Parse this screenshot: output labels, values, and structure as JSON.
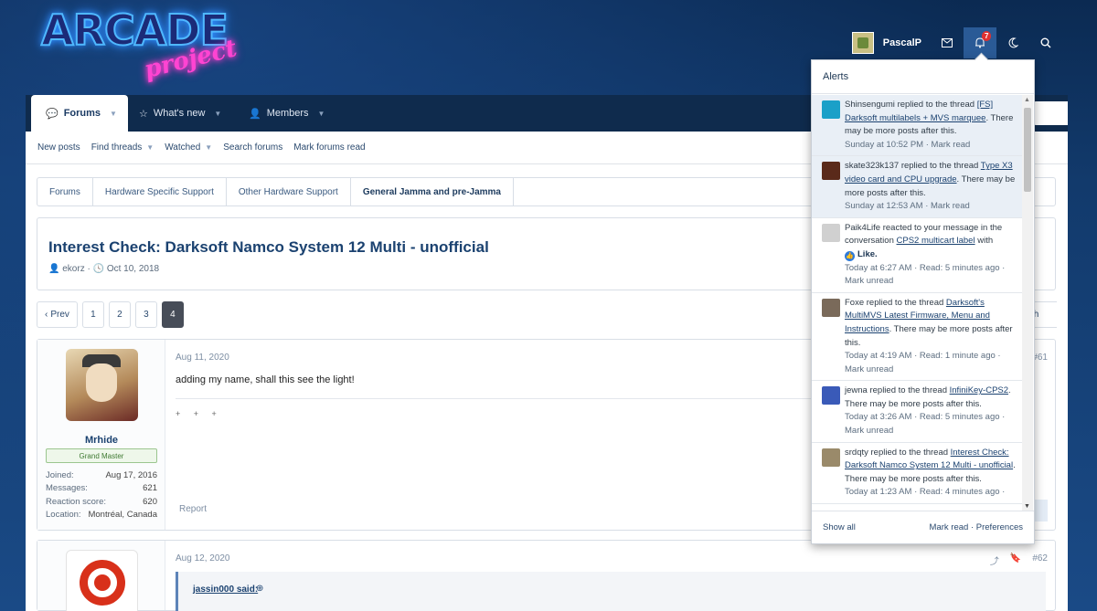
{
  "logo": {
    "main": "ARCADE",
    "sub": "project"
  },
  "user_bar": {
    "username": "PascalP",
    "alerts_count": "7"
  },
  "nav": {
    "tabs": [
      {
        "label": "Forums"
      },
      {
        "label": "What's new"
      },
      {
        "label": "Members"
      }
    ]
  },
  "subnav": {
    "items": [
      "New posts",
      "Find threads",
      "Watched",
      "Search forums",
      "Mark forums read"
    ]
  },
  "breadcrumb": [
    "Forums",
    "Hardware Specific Support",
    "Other Hardware Support",
    "General Jamma and pre-Jamma"
  ],
  "thread": {
    "title": "Interest Check: Darksoft Namco System 12 Multi - unofficial",
    "author": "ekorz",
    "date": "Oct 10, 2018"
  },
  "pager": {
    "prev": "Prev",
    "pages": [
      "1",
      "2",
      "3",
      "4"
    ],
    "current": "4",
    "watch_partial": "tch"
  },
  "posts": [
    {
      "date": "Aug 11, 2020",
      "number": "#61",
      "text": "adding my name, shall this see the light!",
      "signature": "+ + +",
      "report": "Report",
      "reply_partial": "y",
      "user": {
        "name": "Mrhide",
        "title": "Grand Master",
        "stats": [
          {
            "k": "Joined:",
            "v": "Aug 17, 2016"
          },
          {
            "k": "Messages:",
            "v": "621"
          },
          {
            "k": "Reaction score:",
            "v": "620"
          },
          {
            "k": "Location:",
            "v": "Montréal, Canada"
          }
        ]
      }
    },
    {
      "date": "Aug 12, 2020",
      "number": "#62",
      "quote_author": "jassin000 said:"
    }
  ],
  "alerts": {
    "title": "Alerts",
    "footer": {
      "show_all": "Show all",
      "mark_read": "Mark read",
      "sep": "·",
      "preferences": "Preferences"
    },
    "items": [
      {
        "user": "Shinsengumi",
        "action": "replied to the thread",
        "link": "[FS] Darksoft multilabels + MVS marquee",
        "after": ". There may be more posts after this.",
        "time": "Sunday at 10:52 PM",
        "tail": "· Mark read",
        "unread": true,
        "color": "#1aa0c8"
      },
      {
        "user": "skate323k137",
        "action": "replied to the thread",
        "link": "Type X3 video card and CPU upgrade",
        "after": ". There may be more posts after this.",
        "time": "Sunday at 12:53 AM",
        "tail": "· Mark read",
        "unread": true,
        "color": "#5a2a1a"
      },
      {
        "user": "Paik4Life",
        "action": "reacted to your message in the conversation",
        "link": "CPS2 multicart label",
        "after": " with",
        "like": "Like.",
        "time": "Today at 6:27 AM",
        "tail": "· Read: 5 minutes ago · Mark unread",
        "unread": false,
        "color": "#d0d0d0"
      },
      {
        "user": "Foxe",
        "action": "replied to the thread",
        "link": "Darksoft's MultiMVS Latest Firmware, Menu and Instructions",
        "after": ". There may be more posts after this.",
        "time": "Today at 4:19 AM",
        "tail": "· Read: 1 minute ago · Mark unread",
        "unread": false,
        "color": "#7a6a5a"
      },
      {
        "user": "jewna",
        "action": "replied to the thread",
        "link": "InfiniKey-CPS2",
        "after": ". There may be more posts after this.",
        "time": "Today at 3:26 AM",
        "tail": "· Read: 5 minutes ago · Mark unread",
        "unread": false,
        "color": "#3a5ab8"
      },
      {
        "user": "srdqty",
        "action": "replied to the thread",
        "link": "Interest Check: Darksoft Namco System 12 Multi - unofficial",
        "after": ". There may be more posts after this.",
        "time": "Today at 1:23 AM",
        "tail": "· Read: 4 minutes ago ·",
        "unread": false,
        "color": "#9a8a6a"
      }
    ]
  }
}
